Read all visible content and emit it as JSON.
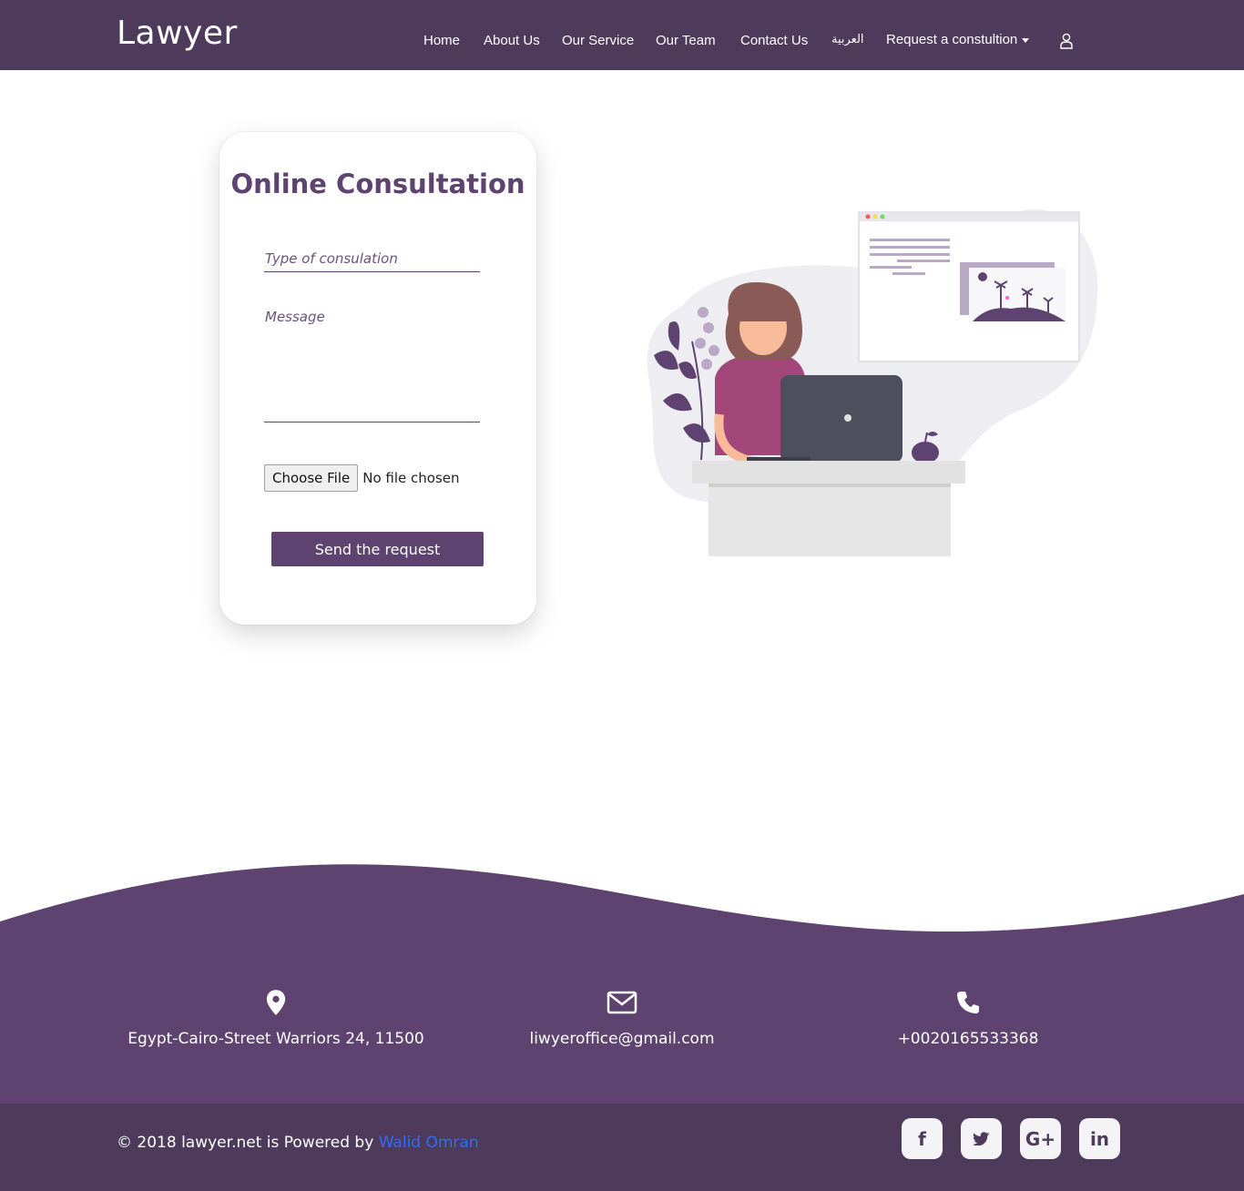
{
  "navbar": {
    "brand": "Lawyer",
    "links": [
      "Home",
      "About Us",
      "Our Service",
      "Our Team",
      "Contact Us",
      "العربية"
    ],
    "dropdown_label": "Request a constultion",
    "user_icon": "user-icon"
  },
  "form": {
    "title": "Online Consultation",
    "type_placeholder": "Type of consulation",
    "message_placeholder": "Message",
    "file_button": "Choose File",
    "file_status": "No file chosen",
    "submit_label": "Send the request"
  },
  "illustration": {
    "icon": "woman-at-laptop-illustration"
  },
  "footer": {
    "address": "Egypt-Cairo-Street Warriors 24, 11500",
    "email": "liwyeroffice@gmail.com",
    "phone": "+0020165533368",
    "copyright_prefix": "© 2018 lawyer.net is Powered by ",
    "author": "Walid Omran",
    "social": [
      "f",
      "twitter-bird",
      "G+",
      "in"
    ]
  },
  "colors": {
    "nav_bg": "#4e3b5c",
    "accent": "#5e4370",
    "footer_bg": "#5e4370",
    "footer_bottom_bg": "#4e3b5c",
    "link": "#2f6bff"
  }
}
